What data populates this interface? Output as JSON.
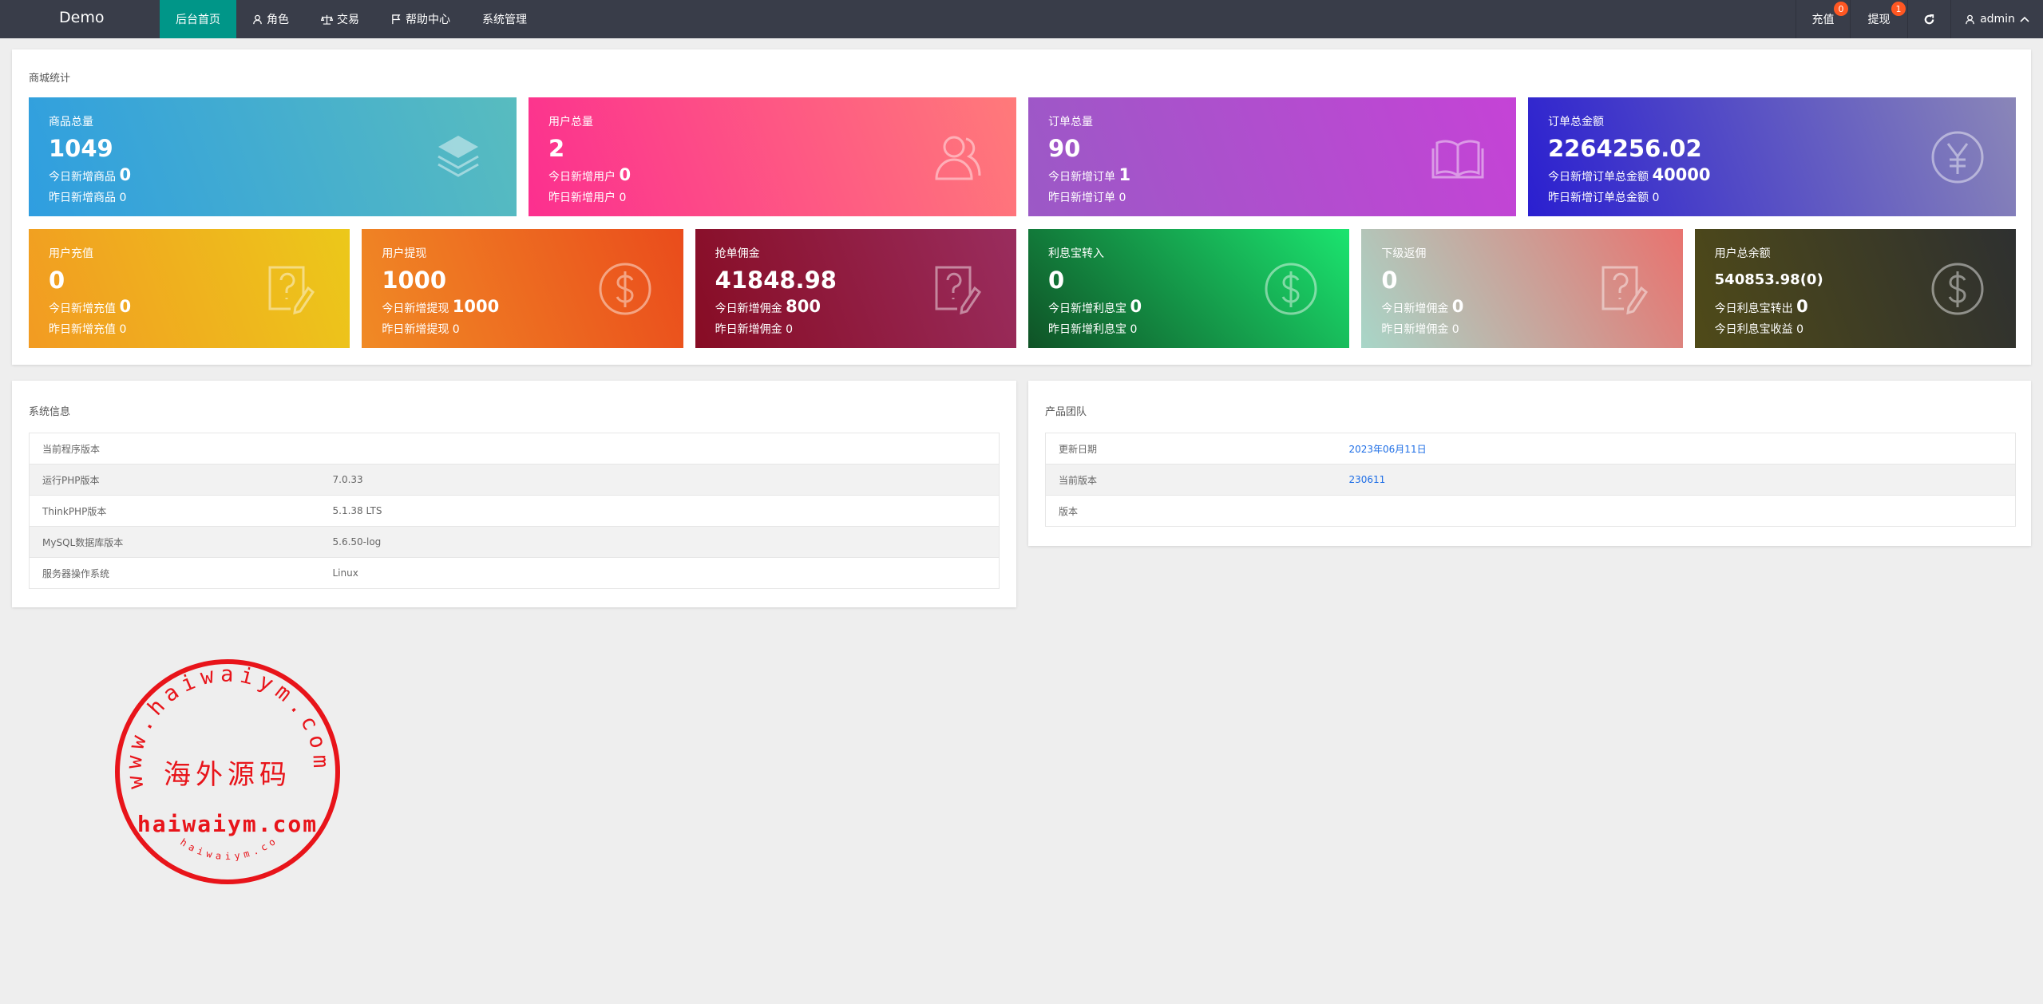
{
  "nav": {
    "logo": "Demo",
    "items": [
      {
        "label": "后台首页",
        "icon": ""
      },
      {
        "label": "角色",
        "icon": "user-icon"
      },
      {
        "label": "交易",
        "icon": "scale-icon"
      },
      {
        "label": "帮助中心",
        "icon": "flag-icon"
      },
      {
        "label": "系统管理",
        "icon": ""
      }
    ],
    "recharge": {
      "label": "充值",
      "badge": "0"
    },
    "withdraw": {
      "label": "提现",
      "badge": "1"
    },
    "refresh_icon": "refresh-icon",
    "user": "admin"
  },
  "stats": {
    "title": "商城统计",
    "cards": [
      {
        "title": "商品总量",
        "value": "1049",
        "today_label": "今日新增商品",
        "today_value": "0",
        "yesterday_label": "昨日新增商品",
        "yesterday_value": "0",
        "icon": "layers",
        "gradient": [
          "#2f9ee0",
          "#58bcbf"
        ]
      },
      {
        "title": "用户总量",
        "value": "2",
        "today_label": "今日新增用户",
        "today_value": "0",
        "yesterday_label": "昨日新增用户",
        "yesterday_value": "0",
        "icon": "users",
        "gradient": [
          "#fc2f8f",
          "#ff7a7a"
        ]
      },
      {
        "title": "订单总量",
        "value": "90",
        "today_label": "今日新增订单",
        "today_value": "1",
        "yesterday_label": "昨日新增订单",
        "yesterday_value": "0",
        "icon": "book",
        "gradient": [
          "#9b59c6",
          "#c543d6"
        ]
      },
      {
        "title": "订单总金额",
        "value": "2264256.02",
        "today_label": "今日新增订单总金额",
        "today_value": "40000",
        "yesterday_label": "昨日新增订单总金额",
        "yesterday_value": "0",
        "icon": "yen",
        "gradient": [
          "#2a1fd0",
          "#8a86b8"
        ]
      },
      {
        "title": "用户充值",
        "value": "0",
        "today_label": "今日新增充值",
        "today_value": "0",
        "yesterday_label": "昨日新增充值",
        "yesterday_value": "0",
        "icon": "question",
        "gradient": [
          "#f29b22",
          "#ecc81a"
        ]
      },
      {
        "title": "用户提现",
        "value": "1000",
        "today_label": "今日新增提现",
        "today_value": "1000",
        "yesterday_label": "昨日新增提现",
        "yesterday_value": "0",
        "icon": "dollar",
        "gradient": [
          "#f08a25",
          "#ea4c1c"
        ]
      },
      {
        "title": "抢单佣金",
        "value": "41848.98",
        "today_label": "今日新增佣金",
        "today_value": "800",
        "yesterday_label": "昨日新增佣金",
        "yesterday_value": "0",
        "icon": "question",
        "gradient": [
          "#870c24",
          "#9a2d5e"
        ]
      },
      {
        "title": "利息宝转入",
        "value": "0",
        "today_label": "今日新增利息宝",
        "today_value": "0",
        "yesterday_label": "昨日新增利息宝",
        "yesterday_value": "0",
        "icon": "dollar",
        "gradient": [
          "#0f5226",
          "#1be46f"
        ]
      },
      {
        "title": "下级返佣",
        "value": "0",
        "today_label": "今日新增佣金",
        "today_value": "0",
        "yesterday_label": "昨日新增佣金",
        "yesterday_value": "0",
        "icon": "question",
        "gradient": [
          "#a8d6c8",
          "#e8736f"
        ]
      },
      {
        "title": "用户总余额",
        "value": "540853.98(0)",
        "today_label": "今日利息宝转出",
        "today_value": "0",
        "yesterday_label": "今日利息宝收益",
        "yesterday_value": "0",
        "icon": "dollar",
        "gradient": [
          "#4f4a18",
          "#2e3030"
        ]
      }
    ]
  },
  "system": {
    "title": "系统信息",
    "rows": [
      [
        "当前程序版本",
        ""
      ],
      [
        "运行PHP版本",
        "7.0.33"
      ],
      [
        "ThinkPHP版本",
        "5.1.38 LTS"
      ],
      [
        "MySQL数据库版本",
        "5.6.50-log"
      ],
      [
        "服务器操作系统",
        "Linux"
      ]
    ]
  },
  "team": {
    "title": "产品团队",
    "rows": [
      [
        "更新日期",
        "2023年06月11日"
      ],
      [
        "当前版本",
        "230611"
      ],
      [
        "版本",
        ""
      ]
    ]
  },
  "watermark": {
    "ring": "www.haiwaiym.com",
    "center": "海外源码",
    "domain": "haiwaiym.com",
    "bottom": "haiwaiym.com",
    "color": "#e8141a"
  }
}
